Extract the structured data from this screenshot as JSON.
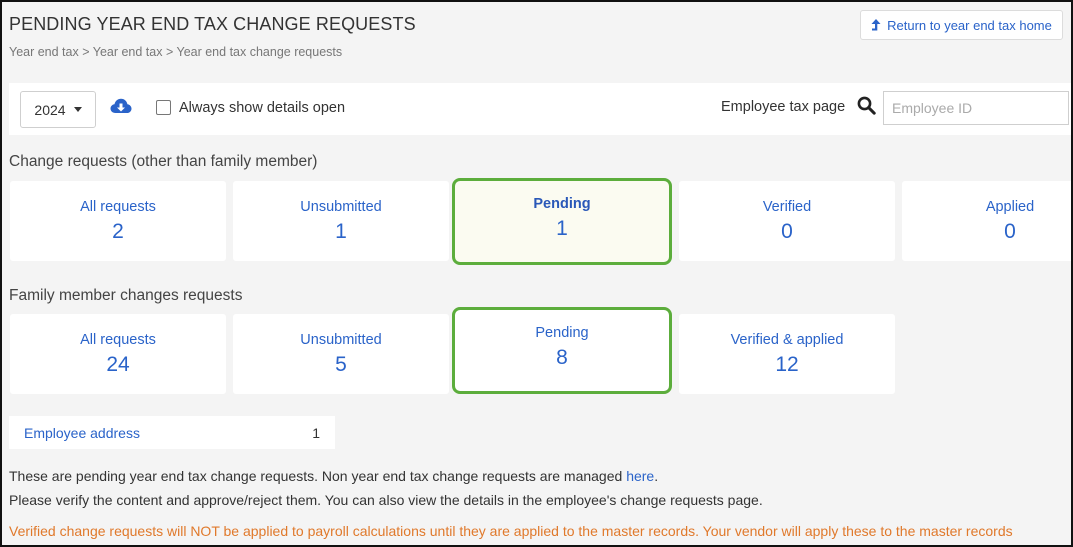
{
  "header": {
    "title": "PENDING YEAR END TAX CHANGE REQUESTS",
    "breadcrumb": "Year end tax > Year end tax > Year end tax change requests",
    "return_label": "Return to year end tax home"
  },
  "toolbar": {
    "year": "2024",
    "show_details_label": "Always show details open",
    "show_details_checked": false,
    "employee_tax_label": "Employee tax page",
    "employee_id_placeholder": "Employee ID"
  },
  "change_requests": {
    "title": "Change requests (other than family member)",
    "cards": [
      {
        "label": "All requests",
        "count": "2"
      },
      {
        "label": "Unsubmitted",
        "count": "1"
      },
      {
        "label": "Pending",
        "count": "1"
      },
      {
        "label": "Verified",
        "count": "0"
      },
      {
        "label": "Applied",
        "count": "0"
      }
    ]
  },
  "family_requests": {
    "title": "Family member changes requests",
    "cards": [
      {
        "label": "All requests",
        "count": "24"
      },
      {
        "label": "Unsubmitted",
        "count": "5"
      },
      {
        "label": "Pending",
        "count": "8"
      },
      {
        "label": "Verified & applied",
        "count": "12"
      }
    ]
  },
  "address_row": {
    "label": "Employee address",
    "count": "1"
  },
  "info": {
    "line1_prefix": "These are pending year end tax change requests. Non year end tax change requests are managed ",
    "line1_link": "here",
    "line1_suffix": ".",
    "line2": "Please verify the content and approve/reject them. You can also view the details in the employee's change requests page.",
    "warning": "Verified change requests will NOT be applied to payroll calculations until they are applied to the master records. Your vendor will apply these to the master records"
  },
  "colors": {
    "link": "#2a63c9",
    "highlight_border": "#5cad3c",
    "warning": "#e0792b"
  },
  "icons": {
    "return": "upload-arrow-icon",
    "download": "cloud-download-icon",
    "search": "search-icon"
  }
}
